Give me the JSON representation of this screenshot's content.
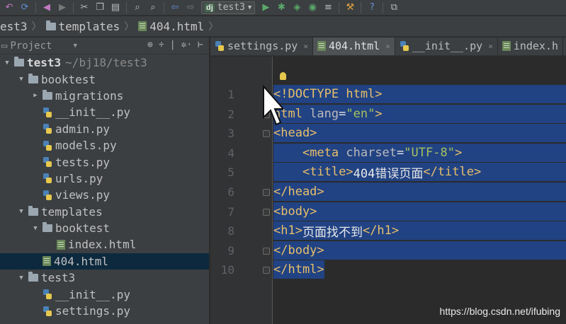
{
  "toolbar": {
    "run_config_badge": "dj",
    "run_config_name": "test3",
    "icons": [
      "undo-icon",
      "redo-icon",
      "back-icon",
      "forward-icon",
      "cut-icon",
      "copy-icon",
      "paste-icon",
      "search-icon",
      "replace-icon",
      "nav-back-icon",
      "nav-forward-icon",
      "run-icon",
      "debug-icon",
      "coverage-icon",
      "profile-icon",
      "tasks-icon",
      "settings-icon",
      "help-icon",
      "plugin-icon"
    ]
  },
  "breadcrumb": [
    {
      "label": "est3",
      "icon": "folder-icon"
    },
    {
      "label": "templates",
      "icon": "folder-icon"
    },
    {
      "label": "404.html",
      "icon": "html-file-icon"
    }
  ],
  "project_panel": {
    "title": "Project",
    "tree": [
      {
        "label": "test3",
        "extra": "~/bj18/test3",
        "type": "folder",
        "depth": 0,
        "expanded": true,
        "root": true
      },
      {
        "label": "booktest",
        "type": "folder",
        "depth": 1,
        "expanded": true
      },
      {
        "label": "migrations",
        "type": "folder",
        "depth": 2,
        "expanded": false
      },
      {
        "label": "__init__.py",
        "type": "py",
        "depth": 2
      },
      {
        "label": "admin.py",
        "type": "py",
        "depth": 2
      },
      {
        "label": "models.py",
        "type": "py",
        "depth": 2
      },
      {
        "label": "tests.py",
        "type": "py",
        "depth": 2
      },
      {
        "label": "urls.py",
        "type": "py",
        "depth": 2
      },
      {
        "label": "views.py",
        "type": "py",
        "depth": 2
      },
      {
        "label": "templates",
        "type": "folder",
        "depth": 1,
        "expanded": true
      },
      {
        "label": "booktest",
        "type": "folder",
        "depth": 2,
        "expanded": true
      },
      {
        "label": "index.html",
        "type": "html",
        "depth": 3
      },
      {
        "label": "404.html",
        "type": "html",
        "depth": 2,
        "selected": true
      },
      {
        "label": "test3",
        "type": "folder",
        "depth": 1,
        "expanded": true
      },
      {
        "label": "__init__.py",
        "type": "py",
        "depth": 2
      },
      {
        "label": "settings.py",
        "type": "py",
        "depth": 2
      }
    ]
  },
  "tabs": [
    {
      "label": "settings.py",
      "icon": "py",
      "active": false
    },
    {
      "label": "404.html",
      "icon": "html",
      "active": true
    },
    {
      "label": "__init__.py",
      "icon": "py",
      "active": false
    },
    {
      "label": "index.h",
      "icon": "html",
      "active": false
    }
  ],
  "editor": {
    "line_numbers": [
      "1",
      "2",
      "3",
      "4",
      "5",
      "6",
      "7",
      "8",
      "9",
      "10"
    ],
    "lines": [
      [
        [
          "tag",
          "<!DOCTYPE html>"
        ]
      ],
      [
        [
          "tag",
          "html "
        ],
        [
          "attr",
          "lang"
        ],
        [
          "txt",
          "="
        ],
        [
          "str",
          "\"en\""
        ],
        [
          "tag",
          ">"
        ]
      ],
      [
        [
          "tag",
          "<head>"
        ]
      ],
      [
        [
          "txt",
          "    "
        ],
        [
          "tag",
          "<meta "
        ],
        [
          "attr",
          "charset"
        ],
        [
          "txt",
          "="
        ],
        [
          "str",
          "\"UTF-8\""
        ],
        [
          "tag",
          ">"
        ]
      ],
      [
        [
          "txt",
          "    "
        ],
        [
          "tag",
          "<title>"
        ],
        [
          "txt",
          "404错误页面"
        ],
        [
          "tag",
          "</title>"
        ]
      ],
      [
        [
          "tag",
          "</head>"
        ]
      ],
      [
        [
          "tag",
          "<body>"
        ]
      ],
      [
        [
          "tag",
          "<h1>"
        ],
        [
          "txt",
          "页面找不到"
        ],
        [
          "tag",
          "</h1>"
        ]
      ],
      [
        [
          "tag",
          "</body>"
        ]
      ],
      [
        [
          "tag",
          "</html>"
        ]
      ]
    ]
  },
  "watermark": "https://blog.csdn.net/ifubing"
}
